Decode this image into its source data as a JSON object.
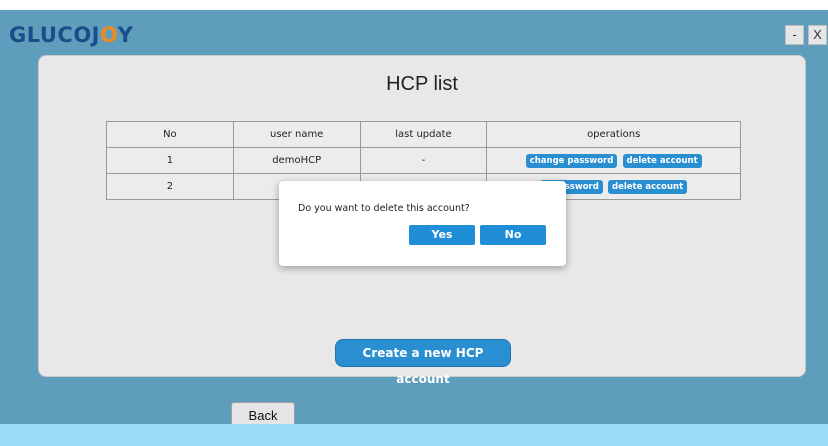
{
  "app": {
    "logo": {
      "part1": "GLUCOJ",
      "part2": "O",
      "part3": "Y"
    },
    "minimize_label": "-",
    "close_label": "X"
  },
  "panel": {
    "title": "HCP list",
    "table": {
      "headers": [
        "No",
        "user name",
        "last update",
        "operations"
      ],
      "rows": [
        {
          "no": "1",
          "user": "demoHCP",
          "last_update": "-",
          "op1": "change password",
          "op2": "delete account"
        },
        {
          "no": "2",
          "user": "",
          "last_update": "",
          "op1": "e password",
          "op2": "delete account"
        }
      ]
    },
    "create_button": "Create a new HCP account"
  },
  "back_button": "Back",
  "dialog": {
    "message": "Do you want to delete this account?",
    "yes": "Yes",
    "no": "No"
  },
  "colors": {
    "app_bg": "#5f9dbd",
    "accent": "#2a8fd1",
    "logo_blue": "#1a4d8a",
    "logo_orange": "#ef8a23"
  }
}
